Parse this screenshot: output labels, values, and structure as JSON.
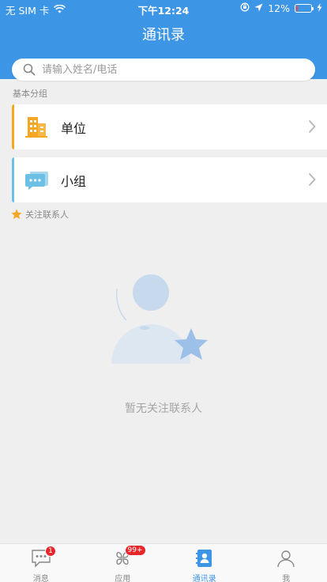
{
  "status_bar": {
    "carrier": "无 SIM 卡",
    "time": "下午12:24",
    "battery_percent": "12%",
    "battery_level": 0.12
  },
  "header": {
    "title": "通讯录"
  },
  "search": {
    "placeholder": "请输入姓名/电话",
    "value": ""
  },
  "groups": {
    "section_label": "基本分组",
    "items": [
      {
        "label": "单位",
        "icon": "building-icon",
        "accent": "#f5a623"
      },
      {
        "label": "小组",
        "icon": "chat-group-icon",
        "accent": "#6cc0e5"
      }
    ]
  },
  "favorites": {
    "label": "关注联系人",
    "icon": "star-icon"
  },
  "empty_state": {
    "message": "暂无关注联系人"
  },
  "tabbar": {
    "tabs": [
      {
        "label": "消息",
        "icon": "message-icon",
        "badge": "1"
      },
      {
        "label": "应用",
        "icon": "apps-icon",
        "badge": "99+"
      },
      {
        "label": "通讯录",
        "icon": "contacts-book-icon",
        "active": true
      },
      {
        "label": "我",
        "icon": "person-icon"
      }
    ]
  },
  "colors": {
    "primary": "#3d95e6",
    "badge": "#e8262a"
  }
}
